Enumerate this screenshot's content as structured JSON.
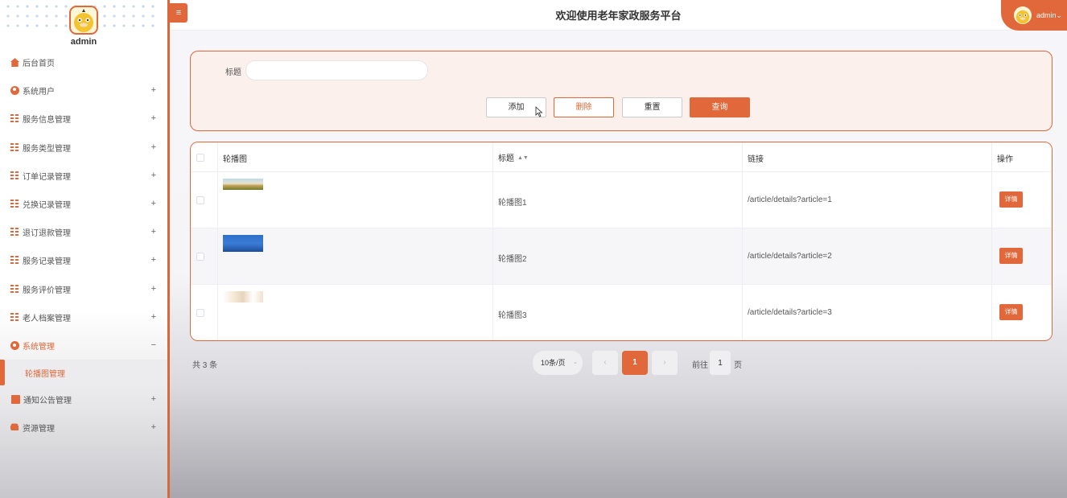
{
  "app": {
    "title": "欢迎使用老年家政服务平台"
  },
  "sidebar": {
    "username": "admin",
    "items": [
      {
        "label": "后台首页",
        "icon": "home-icon",
        "expand": ""
      },
      {
        "label": "系统用户",
        "icon": "user-icon",
        "expand": "+"
      },
      {
        "label": "服务信息管理",
        "icon": "grid-icon",
        "expand": "+"
      },
      {
        "label": "服务类型管理",
        "icon": "grid-icon",
        "expand": "+"
      },
      {
        "label": "订单记录管理",
        "icon": "grid-icon",
        "expand": "+"
      },
      {
        "label": "兑换记录管理",
        "icon": "grid-icon",
        "expand": "+"
      },
      {
        "label": "退订退款管理",
        "icon": "grid-icon",
        "expand": "+"
      },
      {
        "label": "服务记录管理",
        "icon": "grid-icon",
        "expand": "+"
      },
      {
        "label": "服务评价管理",
        "icon": "grid-icon",
        "expand": "+"
      },
      {
        "label": "老人档案管理",
        "icon": "grid-icon",
        "expand": "+"
      },
      {
        "label": "系统管理",
        "icon": "gear-icon",
        "expand": "−",
        "active": true
      },
      {
        "label": "通知公告管理",
        "icon": "document-icon",
        "expand": "+"
      },
      {
        "label": "资源管理",
        "icon": "database-icon",
        "expand": "+"
      }
    ],
    "sub_item": {
      "label": "轮播图管理"
    }
  },
  "header": {
    "menu_toggle": "≡",
    "user_label": "admin",
    "user_chevron": "⌄"
  },
  "search": {
    "label": "标题",
    "value": "",
    "placeholder": "",
    "buttons": {
      "add": "添加",
      "delete": "删除",
      "reset": "重置",
      "query": "查询"
    }
  },
  "table": {
    "columns": [
      "轮播图",
      "标题",
      "链接",
      "操作"
    ],
    "sort_indicator": "▲▼",
    "rows": [
      {
        "title": "轮播图1",
        "link": "/article/details?article=1",
        "action": "详情"
      },
      {
        "title": "轮播图2",
        "link": "/article/details?article=2",
        "action": "详情"
      },
      {
        "title": "轮播图3",
        "link": "/article/details?article=3",
        "action": "详情"
      }
    ]
  },
  "pagination": {
    "total": "共 3 条",
    "page_size": "10条/页",
    "prev": "‹",
    "current": "1",
    "next": "›",
    "goto_label": "前往",
    "goto_value": "1",
    "goto_unit": "页"
  },
  "colors": {
    "accent": "#e0683a",
    "panel_bg": "#fbf0ec"
  }
}
